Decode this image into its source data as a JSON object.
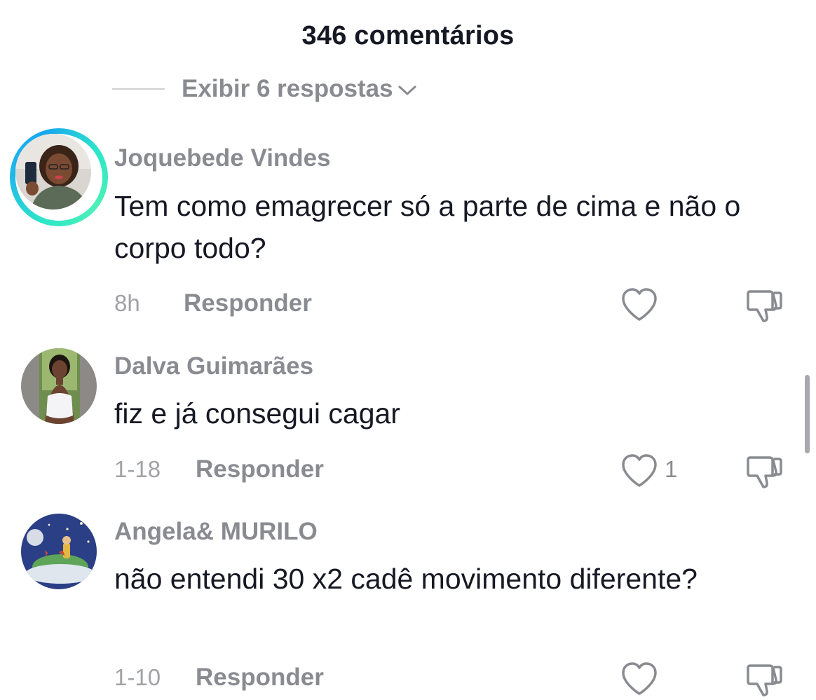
{
  "header": {
    "title": "346 comentários"
  },
  "replies_toggle": {
    "label": "Exibir 6 respostas",
    "icon": "chevron-down-icon"
  },
  "comments": [
    {
      "username": "Joquebede Vindes",
      "text": "Tem como emagrecer só a parte de cima e não o corpo todo?",
      "time": "8h",
      "reply_label": "Responder",
      "like_count": "",
      "has_story_ring": true
    },
    {
      "username": "Dalva Guimarães",
      "text": "fiz e já consegui cagar",
      "time": "1-18",
      "reply_label": "Responder",
      "like_count": "1",
      "has_story_ring": false
    },
    {
      "username": "Angela& MURILO",
      "text": "não entendi 30 x2 cadê movimento diferente?",
      "time": "1-10",
      "reply_label": "Responder",
      "like_count": "",
      "has_story_ring": false
    }
  ],
  "colors": {
    "primary_text": "#161823",
    "secondary_text": "#8a8b91",
    "story_ring": "#2ee6c9"
  }
}
